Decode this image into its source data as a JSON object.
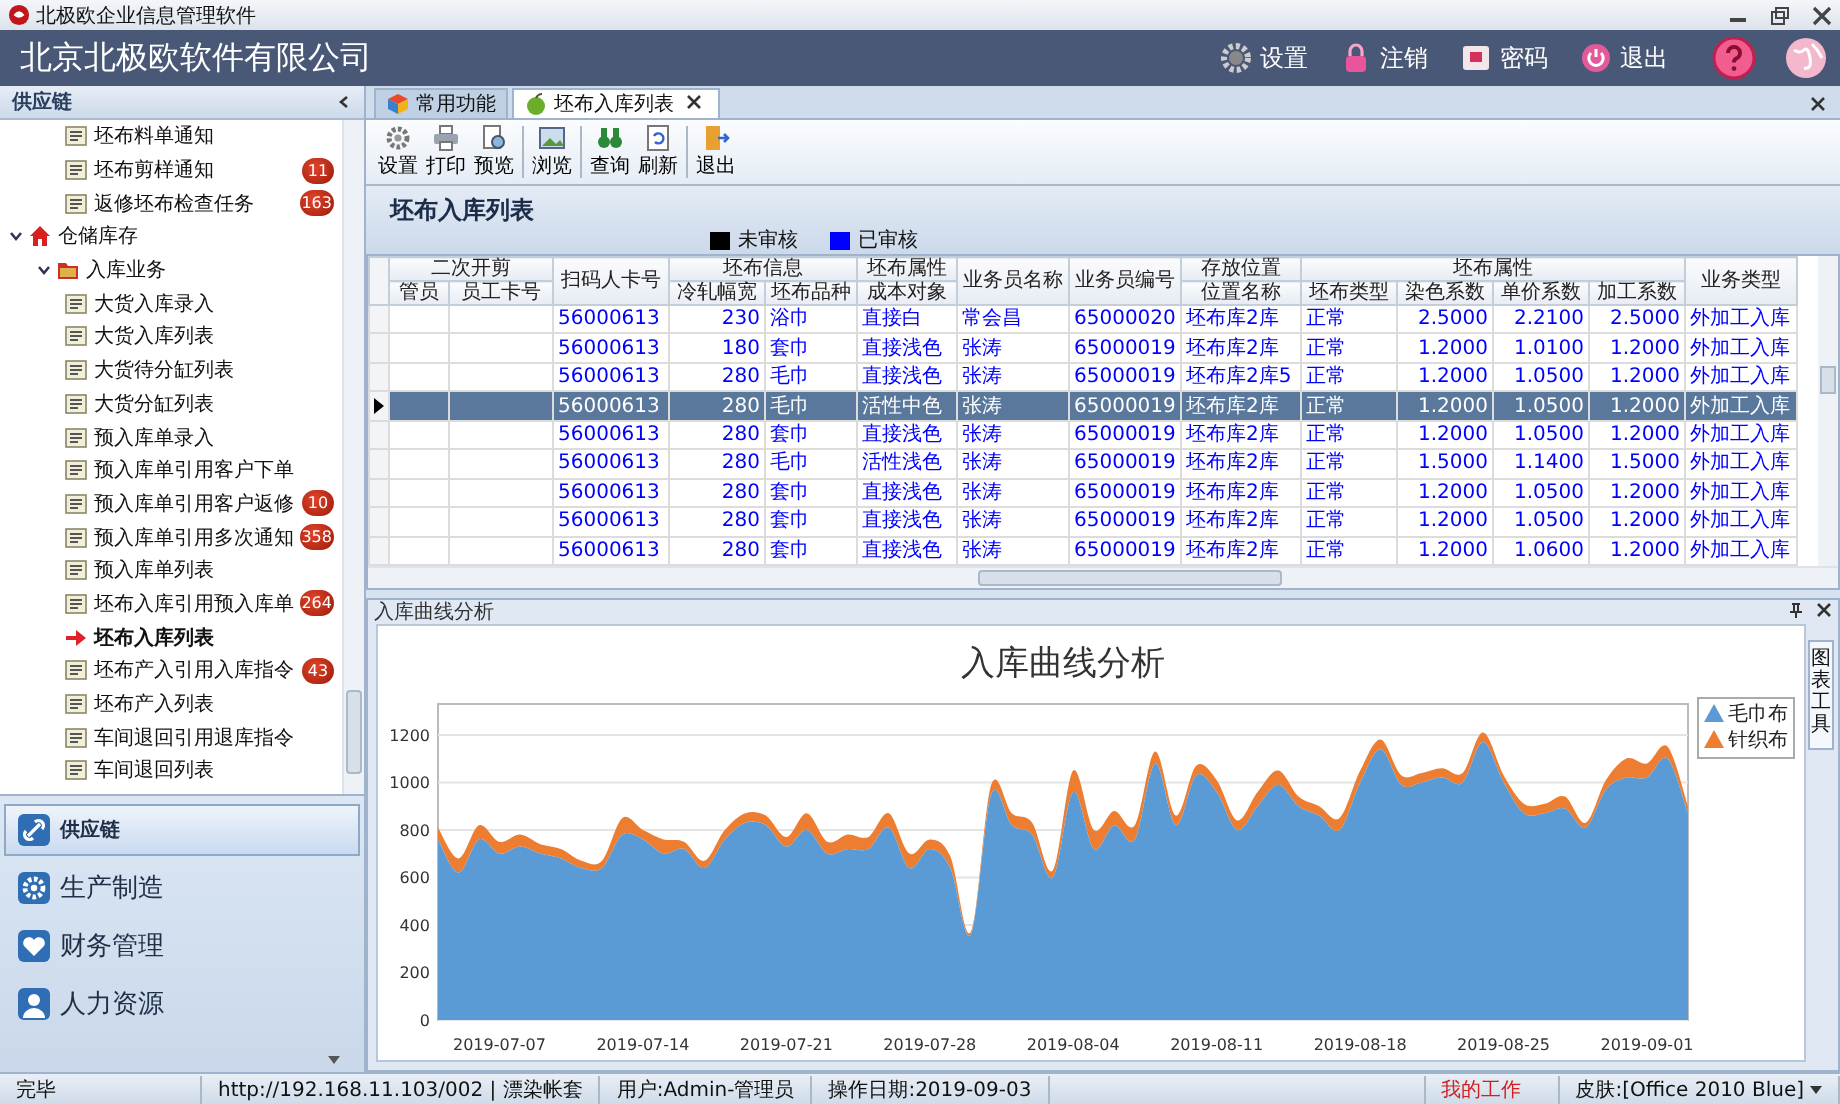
{
  "window": {
    "title": "北极欧企业信息管理软件"
  },
  "header": {
    "title": "北京北极欧软件有限公司",
    "actions": [
      "设置",
      "注销",
      "密码",
      "退出"
    ]
  },
  "sidebar": {
    "title": "供应链",
    "continued_items": [
      {
        "label": "坯布料单通知",
        "selected": false
      },
      {
        "label": "坯布剪样通知",
        "badge": "11",
        "selected": false
      },
      {
        "label": "返修坯布检查任务",
        "badge": "163",
        "selected": false
      }
    ],
    "tree": [
      {
        "label": "仓储库存",
        "kind": "module",
        "expanded": true,
        "children": [
          {
            "label": "入库业务",
            "kind": "folder",
            "expanded": true,
            "children": [
              {
                "label": "大货入库录入",
                "selected": false
              },
              {
                "label": "大货入库列表",
                "selected": false
              },
              {
                "label": "大货待分缸列表",
                "selected": false
              },
              {
                "label": "大货分缸列表",
                "selected": false
              },
              {
                "label": "预入库单录入",
                "selected": false
              },
              {
                "label": "预入库单引用客户下单",
                "selected": false
              },
              {
                "label": "预入库单引用客户返修",
                "badge": "10",
                "selected": false
              },
              {
                "label": "预入库单引用多次通知",
                "badge": "358",
                "selected": false
              },
              {
                "label": "预入库单列表",
                "selected": false
              },
              {
                "label": "坯布入库引用预入库单",
                "badge": "264",
                "selected": false
              },
              {
                "label": "坯布入库列表",
                "selected": true
              },
              {
                "label": "坯布产入引用入库指令",
                "badge": "43",
                "selected": false
              },
              {
                "label": "坯布产入列表",
                "selected": false
              },
              {
                "label": "车间退回引用退库指令",
                "selected": false
              },
              {
                "label": "车间退回列表",
                "selected": false
              }
            ]
          }
        ]
      }
    ],
    "nav": [
      {
        "label": "供应链",
        "selected": true
      },
      {
        "label": "生产制造",
        "selected": false
      },
      {
        "label": "财务管理",
        "selected": false
      },
      {
        "label": "人力资源",
        "selected": false
      }
    ]
  },
  "tabs": [
    {
      "label": "常用功能",
      "selected": false,
      "closable": false
    },
    {
      "label": "坯布入库列表",
      "selected": true,
      "closable": true
    }
  ],
  "toolbar": [
    [
      "设置",
      "打印",
      "预览"
    ],
    [
      "浏览"
    ],
    [
      "查询",
      "刷新"
    ],
    [
      "退出"
    ]
  ],
  "panel": {
    "title": "坯布入库列表",
    "legend": [
      {
        "label": "未审核",
        "color": "#000000"
      },
      {
        "label": "已审核",
        "color": "#0000ff"
      }
    ]
  },
  "table": {
    "column_groups": [
      {
        "label": "二次开剪",
        "columns": [
          {
            "label": "管员"
          },
          {
            "label": "员工卡号"
          }
        ]
      },
      {
        "columns": [
          {
            "label": "扫码人卡号"
          }
        ]
      },
      {
        "label": "坯布信息",
        "columns": [
          {
            "label": "冷轧幅宽",
            "kind": "number"
          },
          {
            "label": "坯布品种"
          }
        ]
      },
      {
        "label": "坯布属性",
        "columns": [
          {
            "label": "成本对象"
          }
        ]
      },
      {
        "columns": [
          {
            "label": "业务员名称"
          }
        ]
      },
      {
        "columns": [
          {
            "label": "业务员编号"
          }
        ]
      },
      {
        "label": "存放位置",
        "columns": [
          {
            "label": "位置名称"
          }
        ]
      },
      {
        "label": "坯布属性",
        "columns": [
          {
            "label": "坯布类型"
          },
          {
            "label": "染色系数",
            "kind": "number"
          },
          {
            "label": "单价系数",
            "kind": "number"
          },
          {
            "label": "加工系数",
            "kind": "number"
          }
        ]
      },
      {
        "columns": [
          {
            "label": "业务类型"
          }
        ]
      }
    ],
    "rows": [
      {
        "selected": false,
        "approved": true,
        "cells": [
          "",
          "",
          "56000613",
          "230",
          "浴巾",
          "直接白",
          "常会昌",
          "65000020",
          "坯布库2库",
          "正常",
          "2.5000",
          "2.2100",
          "2.5000",
          "外加工入库"
        ]
      },
      {
        "selected": false,
        "approved": true,
        "cells": [
          "",
          "",
          "56000613",
          "180",
          "套巾",
          "直接浅色",
          "张涛",
          "65000019",
          "坯布库2库",
          "正常",
          "1.2000",
          "1.0100",
          "1.2000",
          "外加工入库"
        ]
      },
      {
        "selected": false,
        "approved": true,
        "cells": [
          "",
          "",
          "56000613",
          "280",
          "毛巾",
          "直接浅色",
          "张涛",
          "65000019",
          "坯布库2库5",
          "正常",
          "1.2000",
          "1.0500",
          "1.2000",
          "外加工入库"
        ]
      },
      {
        "selected": true,
        "approved": true,
        "cells": [
          "",
          "",
          "56000613",
          "280",
          "毛巾",
          "活性中色",
          "张涛",
          "65000019",
          "坯布库2库",
          "正常",
          "1.2000",
          "1.0500",
          "1.2000",
          "外加工入库"
        ]
      },
      {
        "selected": false,
        "approved": true,
        "cells": [
          "",
          "",
          "56000613",
          "280",
          "套巾",
          "直接浅色",
          "张涛",
          "65000019",
          "坯布库2库",
          "正常",
          "1.2000",
          "1.0500",
          "1.2000",
          "外加工入库"
        ]
      },
      {
        "selected": false,
        "approved": true,
        "cells": [
          "",
          "",
          "56000613",
          "280",
          "毛巾",
          "活性浅色",
          "张涛",
          "65000019",
          "坯布库2库",
          "正常",
          "1.5000",
          "1.1400",
          "1.5000",
          "外加工入库"
        ]
      },
      {
        "selected": false,
        "approved": true,
        "cells": [
          "",
          "",
          "56000613",
          "280",
          "套巾",
          "直接浅色",
          "张涛",
          "65000019",
          "坯布库2库",
          "正常",
          "1.2000",
          "1.0500",
          "1.2000",
          "外加工入库"
        ]
      },
      {
        "selected": false,
        "approved": true,
        "cells": [
          "",
          "",
          "56000613",
          "280",
          "套巾",
          "直接浅色",
          "张涛",
          "65000019",
          "坯布库2库",
          "正常",
          "1.2000",
          "1.0500",
          "1.2000",
          "外加工入库"
        ]
      },
      {
        "selected": false,
        "approved": true,
        "cells": [
          "",
          "",
          "56000613",
          "280",
          "套巾",
          "直接浅色",
          "张涛",
          "65000019",
          "坯布库2库",
          "正常",
          "1.2000",
          "1.0600",
          "1.2000",
          "外加工入库"
        ]
      }
    ]
  },
  "chart_panel": {
    "title": "入库曲线分析",
    "side_tab": "图表工具",
    "chart_data": {
      "type": "area",
      "title": "入库曲线分析",
      "stacked": true,
      "categories": [
        null,
        null,
        null,
        "2019-07-07",
        null,
        null,
        null,
        null,
        null,
        null,
        "2019-07-14",
        null,
        null,
        null,
        null,
        null,
        null,
        "2019-07-21",
        null,
        null,
        null,
        null,
        null,
        null,
        "2019-07-28",
        null,
        null,
        null,
        null,
        null,
        null,
        "2019-08-04",
        null,
        null,
        null,
        null,
        null,
        null,
        "2019-08-11",
        null,
        null,
        null,
        null,
        null,
        null,
        "2019-08-18",
        null,
        null,
        null,
        null,
        null,
        null,
        "2019-08-25",
        null,
        null,
        null,
        null,
        null,
        null,
        "2019-09-01",
        null,
        null
      ],
      "series": [
        {
          "name": "毛巾布",
          "color": "#5b9bd5",
          "values": [
            760,
            620,
            760,
            700,
            730,
            700,
            680,
            640,
            640,
            780,
            760,
            700,
            720,
            640,
            760,
            830,
            820,
            730,
            800,
            700,
            720,
            720,
            810,
            640,
            720,
            640,
            360,
            950,
            820,
            780,
            600,
            960,
            720,
            820,
            760,
            1080,
            820,
            1030,
            960,
            800,
            900,
            990,
            900,
            860,
            800,
            1000,
            1140,
            990,
            1000,
            1020,
            1000,
            1170,
            1000,
            870,
            870,
            890,
            810,
            970,
            1020,
            1020,
            1100,
            870
          ]
        },
        {
          "name": "针织布",
          "color": "#ed7d31",
          "values": [
            50,
            60,
            60,
            50,
            50,
            40,
            40,
            30,
            30,
            70,
            40,
            60,
            30,
            30,
            40,
            40,
            40,
            40,
            70,
            50,
            60,
            50,
            60,
            60,
            40,
            50,
            10,
            40,
            50,
            50,
            30,
            90,
            80,
            60,
            60,
            50,
            40,
            40,
            50,
            40,
            60,
            60,
            40,
            40,
            50,
            50,
            40,
            40,
            40,
            40,
            40,
            40,
            30,
            40,
            40,
            50,
            20,
            40,
            80,
            60,
            50,
            30
          ]
        }
      ],
      "ylim": [
        0,
        1330
      ],
      "grid": true,
      "legend": "right",
      "yticks": [
        0,
        200,
        400,
        600,
        800,
        1000,
        1200
      ]
    }
  },
  "status_bar": [
    {
      "text": "完毕",
      "kind": "plain"
    },
    {
      "text": "http://192.168.11.103/002 | 漂染帐套",
      "kind": "plain"
    },
    {
      "text": "用户:Admin-管理员",
      "kind": "plain"
    },
    {
      "text": "操作日期:2019-09-03",
      "kind": "plain"
    },
    {
      "text": "我的工作",
      "kind": "alert"
    },
    {
      "text": "皮肤:[Office 2010 Blue]",
      "kind": "dropdown"
    }
  ]
}
